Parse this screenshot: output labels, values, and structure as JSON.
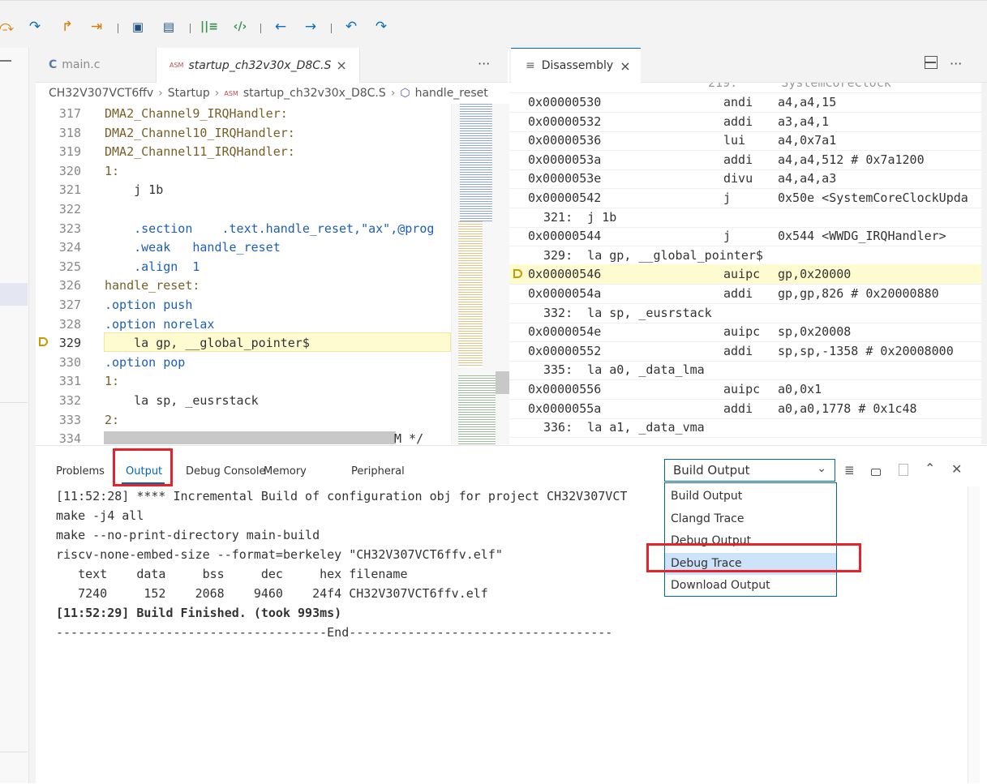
{
  "toolbar": {
    "icons": [
      "step-over-icon",
      "step-into-icon",
      "step-return-icon",
      "run-to-line-icon",
      "help-icon",
      "chat-icon",
      "columns-icon",
      "code-icon",
      "back-icon",
      "forward-icon",
      "undo-icon",
      "redo-icon"
    ]
  },
  "editor": {
    "tabs": [
      {
        "icon": "C",
        "label": "main.c"
      },
      {
        "icon": "ASM",
        "label": "startup_ch32v30x_D8C.S",
        "close": "×"
      }
    ],
    "more": "···",
    "breadcrumb": [
      "CH32V307VCT6ffv",
      "Startup",
      "startup_ch32v30x_D8C.S",
      "handle_reset"
    ],
    "lines": [
      {
        "n": "317",
        "t": "DMA2_Channel9_IRQHandler:"
      },
      {
        "n": "318",
        "t": "DMA2_Channel10_IRQHandler:"
      },
      {
        "n": "319",
        "t": "DMA2_Channel11_IRQHandler:"
      },
      {
        "n": "320",
        "t": "1:"
      },
      {
        "n": "321",
        "t": "    j 1b"
      },
      {
        "n": "322",
        "t": ""
      },
      {
        "n": "323",
        "t": "    .section    .text.handle_reset,\"ax\",@prog"
      },
      {
        "n": "324",
        "t": "    .weak   handle_reset"
      },
      {
        "n": "325",
        "t": "    .align  1"
      },
      {
        "n": "326",
        "t": "handle_reset:"
      },
      {
        "n": "327",
        "t": ".option push"
      },
      {
        "n": "328",
        "t": ".option norelax"
      },
      {
        "n": "329",
        "t": "    la gp, __global_pointer$"
      },
      {
        "n": "330",
        "t": ".option pop"
      },
      {
        "n": "331",
        "t": "1:"
      },
      {
        "n": "332",
        "t": "    la sp, _eusrstack"
      },
      {
        "n": "333",
        "t": "2:"
      },
      {
        "n": "334",
        "t": "M */"
      }
    ]
  },
  "disassembly": {
    "tab_label": "Disassembly",
    "close": "×",
    "top_partial": "219:      SystemCoreClock",
    "rows": [
      {
        "type": "ins",
        "addr": "0x00000530",
        "ins": "andi",
        "ops": "a4,a4,15"
      },
      {
        "type": "ins",
        "addr": "0x00000532",
        "ins": "addi",
        "ops": "a3,a4,1"
      },
      {
        "type": "ins",
        "addr": "0x00000536",
        "ins": "lui",
        "ops": "a4,0x7a1"
      },
      {
        "type": "ins",
        "addr": "0x0000053a",
        "ins": "addi",
        "ops": "a4,a4,512 # 0x7a1200"
      },
      {
        "type": "ins",
        "addr": "0x0000053e",
        "ins": "divu",
        "ops": "a4,a4,a3"
      },
      {
        "type": "ins",
        "addr": "0x00000542",
        "ins": "j",
        "ops": "0x50e <SystemCoreClockUpda"
      },
      {
        "type": "src",
        "text": "321:  j 1b"
      },
      {
        "type": "ins",
        "addr": "0x00000544",
        "ins": "j",
        "ops": "0x544 <WWDG_IRQHandler>"
      },
      {
        "type": "src",
        "text": "329:  la gp, __global_pointer$"
      },
      {
        "type": "ins",
        "addr": "0x00000546",
        "ins": "auipc",
        "ops": "gp,0x20000",
        "current": true
      },
      {
        "type": "ins",
        "addr": "0x0000054a",
        "ins": "addi",
        "ops": "gp,gp,826 # 0x20000880"
      },
      {
        "type": "src",
        "text": "332:  la sp, _eusrstack"
      },
      {
        "type": "ins",
        "addr": "0x0000054e",
        "ins": "auipc",
        "ops": "sp,0x20008"
      },
      {
        "type": "ins",
        "addr": "0x00000552",
        "ins": "addi",
        "ops": "sp,sp,-1358 # 0x20008000"
      },
      {
        "type": "src",
        "text": "335:  la a0, _data_lma"
      },
      {
        "type": "ins",
        "addr": "0x00000556",
        "ins": "auipc",
        "ops": "a0,0x1"
      },
      {
        "type": "ins",
        "addr": "0x0000055a",
        "ins": "addi",
        "ops": "a0,a0,1778 # 0x1c48"
      },
      {
        "type": "src",
        "text": "336:  la a1, _data_vma"
      }
    ]
  },
  "panel": {
    "tabs": [
      "Problems",
      "Output",
      "Debug Console",
      "Memory",
      "Peripheral"
    ],
    "active_tab": "Output",
    "channel_select": "Build Output",
    "dropdown_options": [
      "Build Output",
      "Clangd Trace",
      "Debug Output",
      "Debug Trace",
      "Download Output"
    ],
    "highlighted_option": "Debug Trace",
    "output_lines": [
      "[11:52:28] **** Incremental Build of configuration obj for project CH32V307VCT",
      "make -j4 all",
      "make --no-print-directory main-build",
      "riscv-none-embed-size --format=berkeley \"CH32V307VCT6ffv.elf\"",
      "   text    data     bss     dec     hex filename",
      "   7240     152    2068    9460    24f4 CH32V307VCT6ffv.elf",
      "[11:52:29] Build Finished. (took 993ms)",
      "-------------------------------------End------------------------------------"
    ]
  },
  "colors": {
    "accent": "#0066b8",
    "highlight": "#fffbd0",
    "annotation": "#e8212b",
    "selected_option": "#cce3fa"
  }
}
